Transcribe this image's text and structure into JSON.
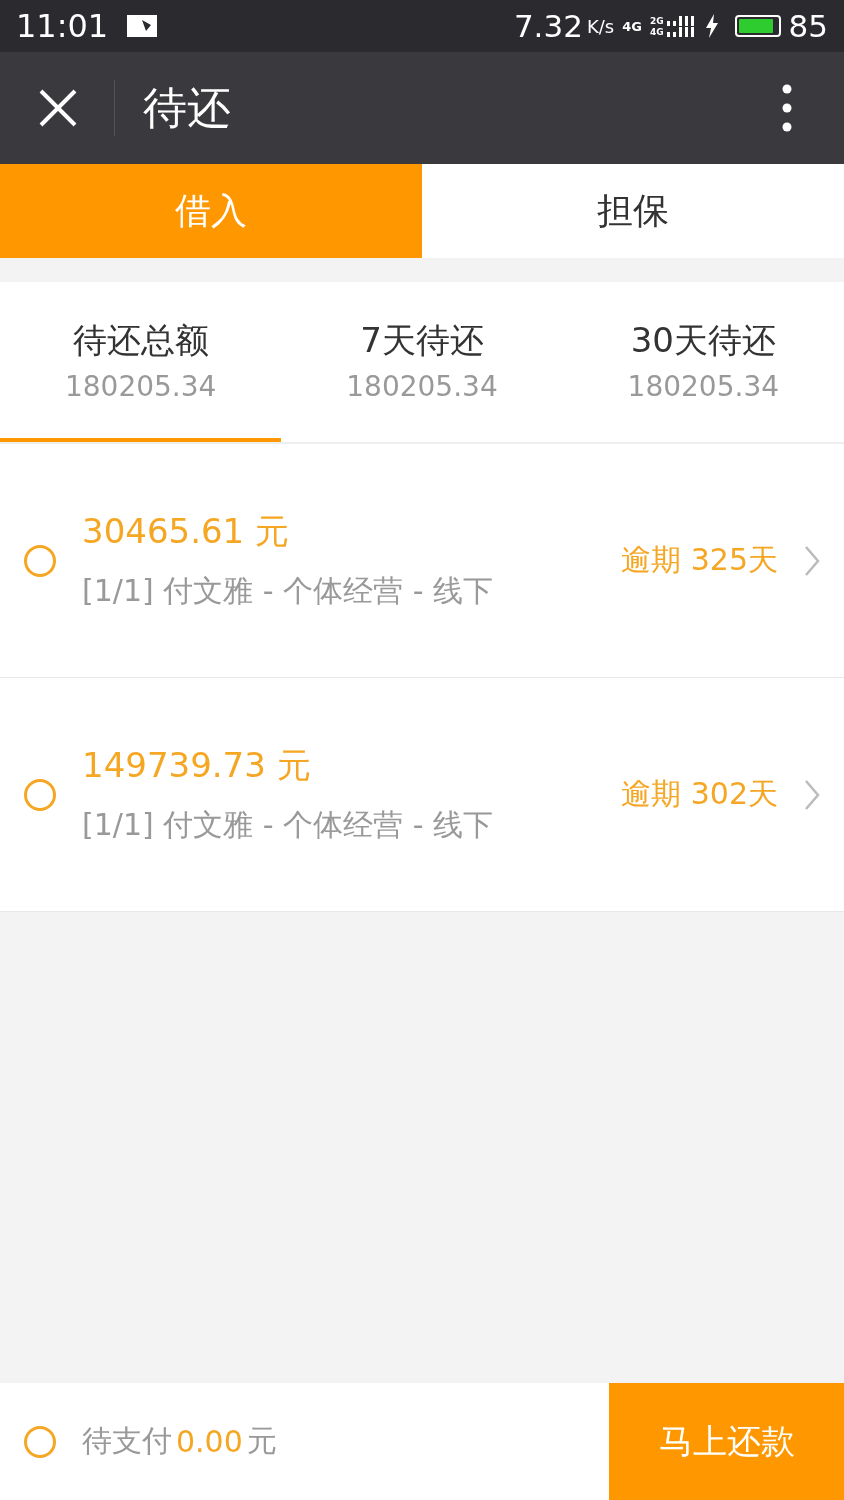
{
  "status_bar": {
    "time": "11:01",
    "speed": "7.32",
    "speed_unit": "K/s",
    "net_type": "4G",
    "signal_labels": [
      "2G",
      "4G"
    ],
    "battery": "85"
  },
  "header": {
    "title": "待还"
  },
  "tabs": [
    {
      "label": "借入",
      "selected": true
    },
    {
      "label": "担保",
      "selected": false
    }
  ],
  "summary": [
    {
      "label": "待还总额",
      "value": "180205.34",
      "selected": true
    },
    {
      "label": "7天待还",
      "value": "180205.34",
      "selected": false
    },
    {
      "label": "30天待还",
      "value": "180205.34",
      "selected": false
    }
  ],
  "loans": [
    {
      "amount": "30465.61 元",
      "detail": "[1/1] 付文雅 - 个体经营 - 线下",
      "status": "逾期 325天",
      "checked": false
    },
    {
      "amount": "149739.73 元",
      "detail": "[1/1] 付文雅 - 个体经营 - 线下",
      "status": "逾期 302天",
      "checked": false
    }
  ],
  "footer": {
    "checked": false,
    "pending_label": "待支付",
    "pending_amount": "0.00",
    "pending_unit": "元",
    "button": "马上还款"
  }
}
